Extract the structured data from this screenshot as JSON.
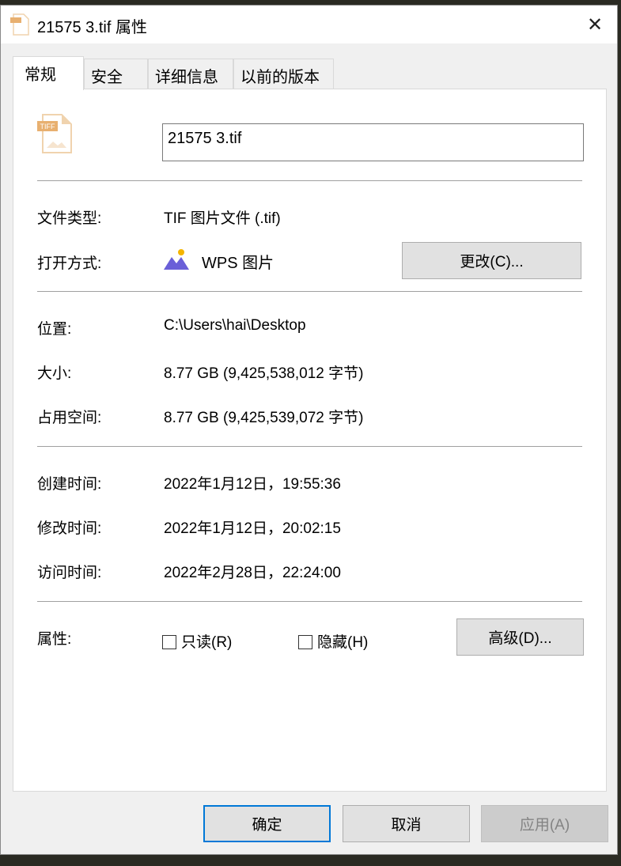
{
  "window": {
    "title": "21575 3.tif 属性",
    "close_icon": "close-icon"
  },
  "tabs": [
    {
      "label": "常规"
    },
    {
      "label": "安全"
    },
    {
      "label": "详细信息"
    },
    {
      "label": "以前的版本"
    }
  ],
  "general": {
    "file_icon_text": "TIFF",
    "filename": "21575 3.tif",
    "file_type_label": "文件类型:",
    "file_type": "TIF 图片文件 (.tif)",
    "open_with_label": "打开方式:",
    "open_with": "WPS 图片",
    "change_button": "更改(C)...",
    "location_label": "位置:",
    "location": "C:\\Users\\hai\\Desktop",
    "size_label": "大小:",
    "size": "8.77 GB (9,425,538,012 字节)",
    "disk_size_label": "占用空间:",
    "disk_size": "8.77 GB (9,425,539,072 字节)",
    "created_label": "创建时间:",
    "created": "2022年1月12日，19:55:36",
    "modified_label": "修改时间:",
    "modified": "2022年1月12日，20:02:15",
    "accessed_label": "访问时间:",
    "accessed": "2022年2月28日，22:24:00",
    "attributes_label": "属性:",
    "readonly": "只读(R)",
    "hidden": "隐藏(H)",
    "advanced_button": "高级(D)..."
  },
  "footer": {
    "ok": "确定",
    "cancel": "取消",
    "apply": "应用(A)"
  }
}
